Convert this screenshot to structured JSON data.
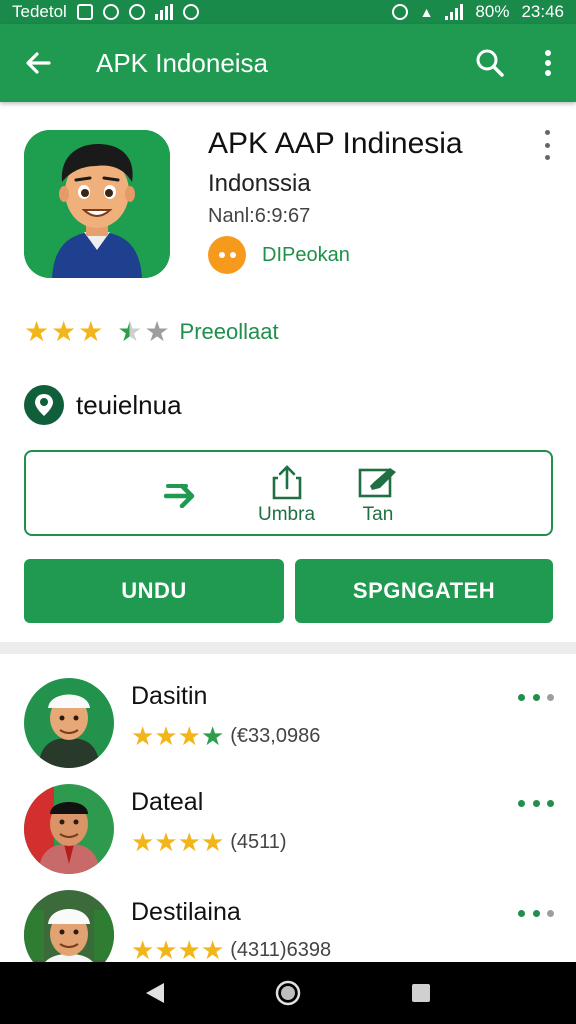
{
  "status_bar": {
    "left_text": "Tedetol",
    "battery": "80%",
    "time": "23:46"
  },
  "app_bar": {
    "title": "APK Indoneisa"
  },
  "app": {
    "name": "APK AAP  Indinesia",
    "developer": "Indonssia",
    "version": "Nanl:6:9:67",
    "badge_label": "DIPeokan",
    "rating_label": "Preeollaat",
    "location_label": "teuielnua"
  },
  "actions": {
    "item2_label": "Umbra",
    "item3_label": "Tan"
  },
  "buttons": {
    "install": "UNDU",
    "share": "SPGNGATEH"
  },
  "list": [
    {
      "name": "Dasitin",
      "count": "(€33,0986"
    },
    {
      "name": "Dateal",
      "count": "(4511)"
    },
    {
      "name": "Destilaina",
      "count": "(4311)6398"
    }
  ],
  "colors": {
    "primary": "#1f9a50",
    "status_bar": "#1a8a4a",
    "accent_text": "#1f8f4a",
    "star": "#f3b61a",
    "badge": "#f59a1c"
  }
}
